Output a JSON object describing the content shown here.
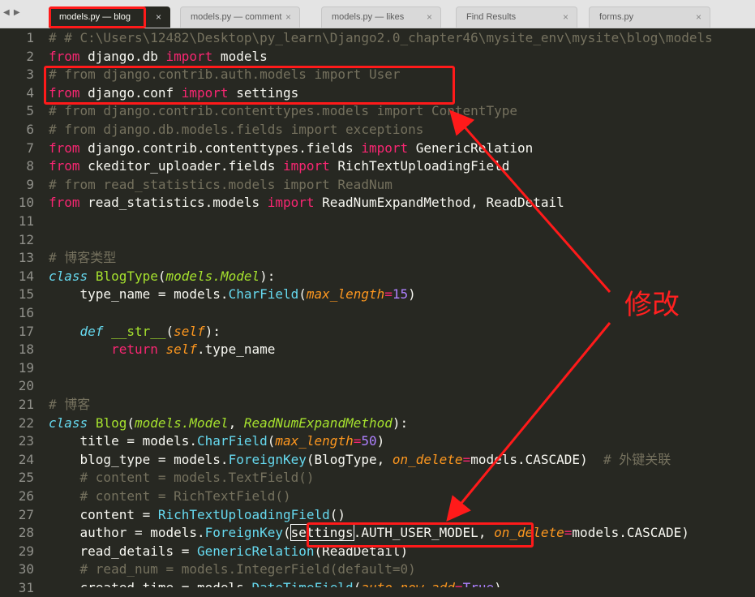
{
  "tabs": [
    {
      "label": "models.py — blog",
      "active": true
    },
    {
      "label": "models.py — comment",
      "active": false
    },
    {
      "label": "models.py — likes",
      "active": false
    },
    {
      "label": "Find Results",
      "active": false
    },
    {
      "label": "forms.py",
      "active": false
    }
  ],
  "tab_close_glyph": "×",
  "nav_arrows": "◀ ▶",
  "line_numbers": [
    "1",
    "2",
    "3",
    "4",
    "5",
    "6",
    "7",
    "8",
    "9",
    "10",
    "11",
    "12",
    "13",
    "14",
    "15",
    "16",
    "17",
    "18",
    "19",
    "20",
    "21",
    "22",
    "23",
    "24",
    "25",
    "26",
    "27",
    "28",
    "29",
    "30",
    "31"
  ],
  "code": {
    "l1": "# # C:\\Users\\12482\\Desktop\\py_learn\\Django2.0_chapter46\\mysite_env\\mysite\\blog\\models",
    "l2": {
      "kw": "from",
      "mod": " django.db ",
      "imp": "import",
      "name": " models"
    },
    "l3": "# from django.contrib.auth.models import User",
    "l4": {
      "kw": "from",
      "mod": " django.conf ",
      "imp": "import",
      "name": " settings"
    },
    "l5": "# from django.contrib.contenttypes.models import ContentType",
    "l6": "# from django.db.models.fields import exceptions",
    "l7": {
      "kw": "from",
      "mod": " django.contrib.contenttypes.fields ",
      "imp": "import",
      "name": " GenericRelation"
    },
    "l8": {
      "kw": "from",
      "mod": " ckeditor_uploader.fields ",
      "imp": "import",
      "name": " RichTextUploadingField"
    },
    "l9": "# from read_statistics.models import ReadNum",
    "l10": {
      "kw": "from",
      "mod": " read_statistics.models ",
      "imp": "import",
      "name": " ReadNumExpandMethod, ReadDetail"
    },
    "l13": "# 博客类型",
    "l14": {
      "kw": "class",
      "name": "BlogType",
      "p1": "(",
      "base": "models.Model",
      "p2": "):"
    },
    "l15": {
      "a": "    type_name = models.",
      "f": "CharField",
      "b": "(",
      "kw": "max_length",
      "eq": "=",
      "num": "15",
      "c": ")"
    },
    "l17": {
      "def": "def",
      "name": "__str__",
      "p1": "(",
      "self": "self",
      "p2": "):"
    },
    "l18": {
      "ret": "return",
      "self": "self",
      "rest": ".type_name"
    },
    "l21": "# 博客",
    "l22": {
      "kw": "class",
      "name": "Blog",
      "p1": "(",
      "b1": "models.Model",
      "sep": ", ",
      "b2": "ReadNumExpandMethod",
      "p2": "):"
    },
    "l23": {
      "a": "    title = models.",
      "f": "CharField",
      "b": "(",
      "kw": "max_length",
      "eq": "=",
      "num": "50",
      "c": ")"
    },
    "l24": {
      "a": "    blog_type = models.",
      "f": "ForeignKey",
      "b": "(BlogType, ",
      "kw": "on_delete",
      "eq": "=",
      "rest": "models.CASCADE)",
      "cm": "  # 外键关联"
    },
    "l25": "    # content = models.TextField()",
    "l26": "    # content = RichTextField()",
    "l27": {
      "a": "    content = ",
      "f": "RichTextUploadingField",
      "b": "()"
    },
    "l28": {
      "a": "    author = models.",
      "f": "ForeignKey",
      "b": "(",
      "s": "settings",
      "m": ".AUTH_USER_MODEL, ",
      "kw": "on_delete",
      "eq": "=",
      "rest": "models.CASCADE)"
    },
    "l29": {
      "a": "    read_details = ",
      "f": "GenericRelation",
      "b": "(ReadDetail)"
    },
    "l30": "    # read_num = models.IntegerField(default=0)",
    "l31": {
      "a": "    created_time = models.",
      "f": "DateTimeField",
      "b": "(",
      "kw": "auto_now_add",
      "eq": "=",
      "v": "True",
      "c": ")"
    }
  },
  "annotation": {
    "text": "修改",
    "color": "#ff1a1a"
  },
  "colors": {
    "background": "#272822",
    "keyword": "#f92672",
    "comment": "#75715e",
    "function": "#a6e22e",
    "storage": "#66d9ef",
    "parameter": "#fd971f",
    "number": "#ae81ff"
  }
}
